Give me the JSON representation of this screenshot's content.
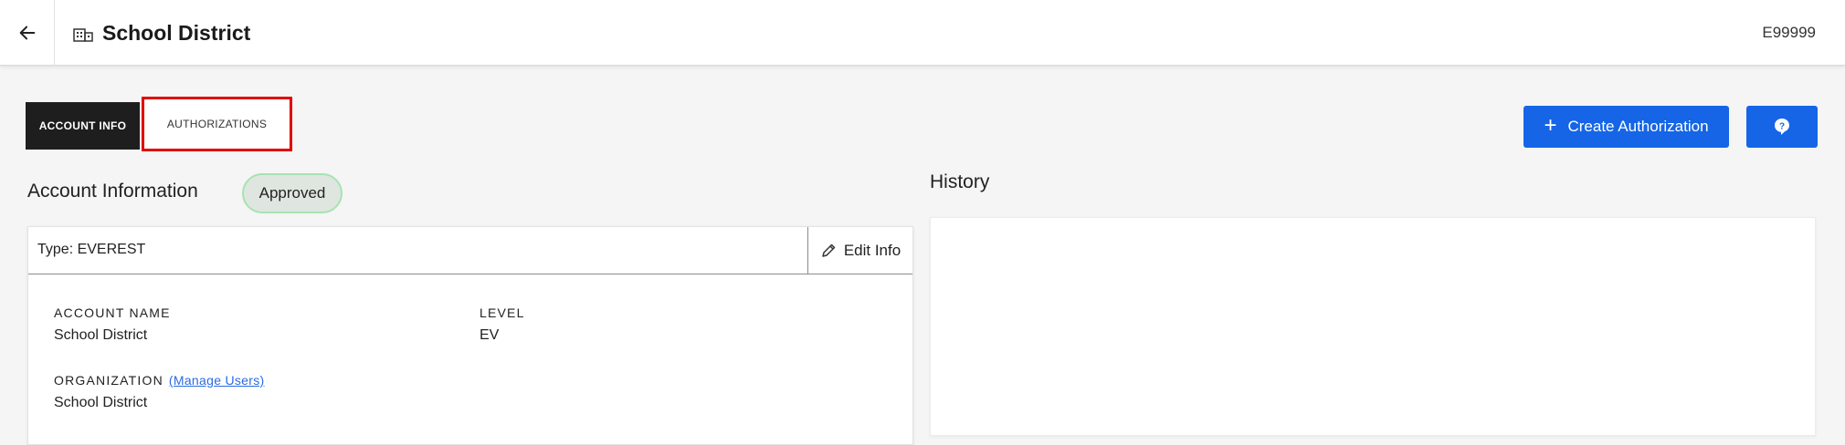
{
  "header": {
    "title": "School District",
    "account_code": "E99999",
    "back_icon": "arrow-left-icon",
    "title_icon": "building-icon"
  },
  "tabs": [
    {
      "label": "ACCOUNT INFO",
      "active": true
    },
    {
      "label": "AUTHORIZATIONS",
      "active": false,
      "highlighted": true
    }
  ],
  "actions": {
    "create_label": "Create Authorization",
    "create_icon": "plus-icon",
    "help_icon": "help-icon"
  },
  "account": {
    "section_title": "Account Information",
    "status": "Approved",
    "type_label": "Type: EVEREST",
    "edit_label": "Edit Info",
    "fields": {
      "account_name_label": "ACCOUNT NAME",
      "account_name_value": "School District",
      "level_label": "LEVEL",
      "level_value": "EV",
      "organization_label": "ORGANIZATION",
      "manage_users_label": "(Manage Users)",
      "organization_value": "School District"
    }
  },
  "history": {
    "section_title": "History"
  },
  "colors": {
    "primary": "#1565e6",
    "tab_active_bg": "#1e1e1e",
    "highlight_border": "#e10000",
    "badge_border": "#a6e3b2"
  }
}
